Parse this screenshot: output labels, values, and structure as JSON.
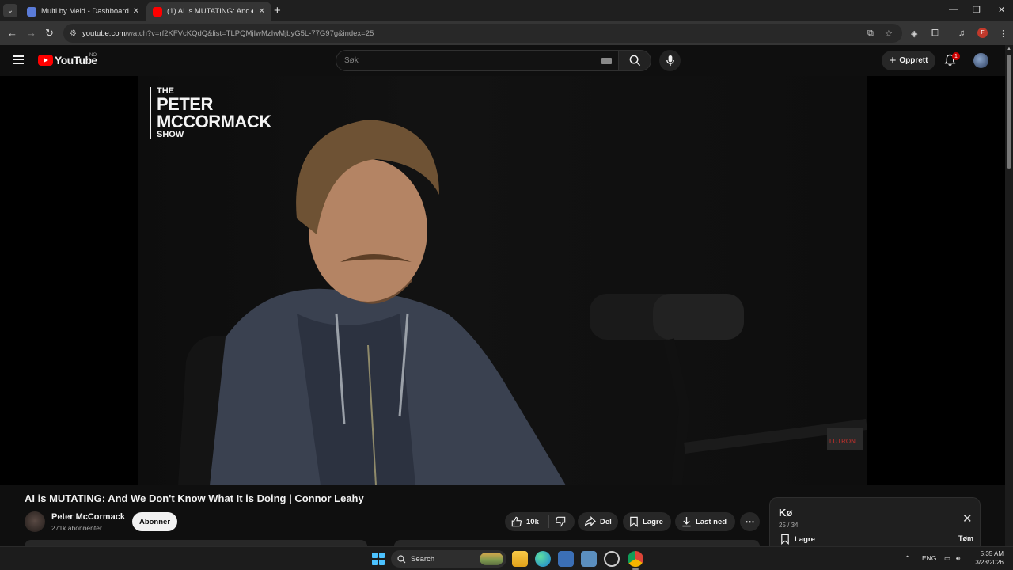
{
  "browser": {
    "tabs": [
      {
        "title": "Multi by Meld - Dashboard.",
        "active": false
      },
      {
        "title": "(1) AI is MUTATING: And W",
        "active": true
      }
    ],
    "url_domain": "youtube.com",
    "url_path": "/watch?v=rf2KFVcKQdQ&list=TLPQMjIwMzIwMjbyG5L-77G97g&index=25",
    "profile_initial": "F"
  },
  "masthead": {
    "logo_text": "YouTube",
    "country_code": "NO",
    "search_placeholder": "Søk",
    "create_label": "Opprett",
    "notification_count": "1"
  },
  "player": {
    "overlay": {
      "line1": "THE",
      "line2": "PETER",
      "line3": "MCCORMACK",
      "line4": "SHOW",
      "mic_brand": "LUTRON"
    }
  },
  "video": {
    "title": "AI is MUTATING: And We Don't Know What It is Doing | Connor Leahy",
    "channel_name": "Peter McCormack",
    "subscribers": "271k abonnenter",
    "subscribe_label": "Abonner",
    "like_count": "10k",
    "share_label": "Del",
    "save_label": "Lagre",
    "download_label": "Last ned"
  },
  "queue": {
    "title": "Kø",
    "position": "25 / 34",
    "save_label": "Lagre",
    "clear_label": "Tøm"
  },
  "taskbar": {
    "search_label": "Search",
    "language": "ENG",
    "time": "5:35 AM",
    "date": "3/23/2026"
  },
  "colors": {
    "youtube_red": "#ff0000",
    "background": "#0f0f0f",
    "pill": "#272727",
    "windows_accent": "#4cc2ff"
  }
}
